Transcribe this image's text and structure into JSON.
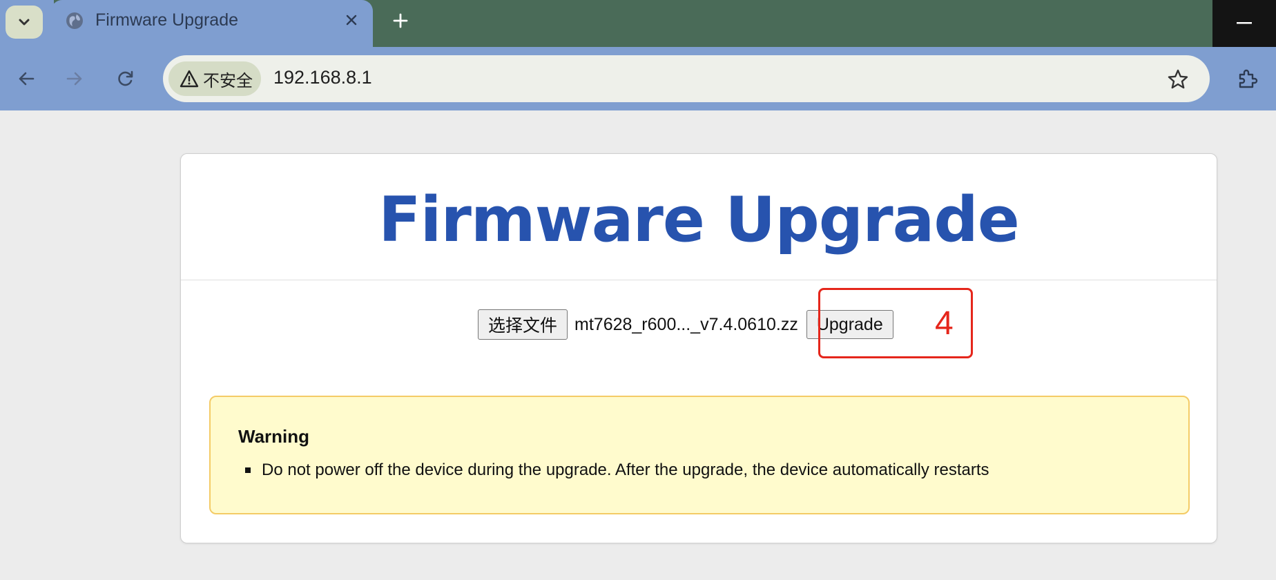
{
  "browser": {
    "tab_title": "Firmware Upgrade",
    "security_label": "不安全",
    "url": "192.168.8.1",
    "icons": {
      "tab_menu": "chevron-down-icon",
      "favicon": "globe-icon",
      "close": "close-icon",
      "new_tab": "plus-icon",
      "minimize": "minimize-icon",
      "back": "back-arrow-icon",
      "forward": "forward-arrow-icon",
      "reload": "reload-icon",
      "warning": "warning-icon",
      "bookmark": "star-icon",
      "extensions": "puzzle-icon"
    }
  },
  "page": {
    "title": "Firmware Upgrade",
    "file_button_label": "选择文件",
    "file_name": "mt7628_r600..._v7.4.0610.zz",
    "upgrade_button_label": "Upgrade",
    "step_annotation": "4",
    "warning": {
      "title": "Warning",
      "items": [
        "Do not power off the device during the upgrade. After the upgrade, the device automatically restarts"
      ]
    }
  },
  "colors": {
    "title": "#2753ae",
    "annotation": "#e5261b",
    "warning_bg": "#fffbcd",
    "warning_border": "#f4cb66",
    "chrome": "#7f9ed0",
    "tabstrip": "#4a6b58"
  }
}
